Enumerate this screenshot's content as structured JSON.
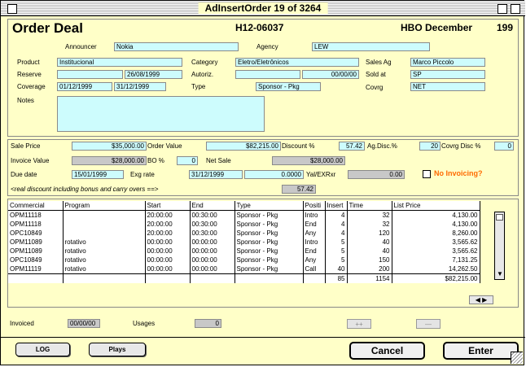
{
  "window": {
    "title": "AdInsertOrder 19 of 3264"
  },
  "header": {
    "heading": "Order Deal",
    "order_id": "H12-06037",
    "channel_period": "HBO December",
    "year": "199"
  },
  "deal": {
    "announcer_label": "Announcer",
    "announcer": "Nokia",
    "agency_label": "Agency",
    "agency": "LEW",
    "product_label": "Product",
    "product": "Institucional",
    "category_label": "Category",
    "category": "Eletro/Eletrônicos",
    "sales_ag_label": "Sales Ag",
    "sales_ag": "Marco Piccolo",
    "reserve_label": "Reserve",
    "reserve_1": "",
    "reserve_2": "26/08/1999",
    "autoriz_label": "Autoriz.",
    "autoriz_1": "",
    "autoriz_2": "00/00/00",
    "sold_at_label": "Sold at",
    "sold_at": "SP",
    "coverage_label": "Coverage",
    "coverage_from": "01/12/1999",
    "coverage_to": "31/12/1999",
    "type_label": "Type",
    "type": "Sponsor - Pkg",
    "covrg_label": "Covrg",
    "covrg": "NET",
    "notes_label": "Notes",
    "notes": ""
  },
  "pricing": {
    "sale_price_label": "Sale Price",
    "sale_price": "$35,000.00",
    "order_value_label": "Order Value",
    "order_value": "$82,215.00",
    "discount_label": "Discount %",
    "discount": "57.42",
    "ag_disc_label": "Ag.Disc.%",
    "ag_disc": "20",
    "covrg_disc_label": "Covrg Disc %",
    "covrg_disc": "0",
    "invoice_value_label": "Invoice Value",
    "invoice_value": "$28,000.00",
    "bo_label": "BO %",
    "bo": "0",
    "net_sale_label": "Net Sale",
    "net_sale": "$28,000.00",
    "due_date_label": "Due date",
    "due_date": "15/01/1999",
    "exg_rate_label": "Exg rate",
    "exg_rate_date": "31/12/1999",
    "exg_rate": "0.0000",
    "yal_label": "Yal/EXRxr",
    "yal": "0.00",
    "no_invoicing_label": "No Invoicing?",
    "real_discount_label": "<real discount including bonus and carry overs ==>",
    "real_discount": "57.42"
  },
  "table": {
    "headers": [
      "Commercial",
      "Program",
      "Start",
      "End",
      "Type",
      "Positi",
      "Insert",
      "Time",
      "List Price"
    ],
    "rows": [
      [
        "OPM11118",
        "",
        "20:00:00",
        "00:30:00",
        "Sponsor - Pkg",
        "Intro",
        "4",
        "32",
        "4,130.00"
      ],
      [
        "OPM11118",
        "",
        "20:00:00",
        "00:30:00",
        "Sponsor - Pkg",
        "End",
        "4",
        "32",
        "4,130.00"
      ],
      [
        "OPC10849",
        "",
        "20:00:00",
        "00:30:00",
        "Sponsor - Pkg",
        "Any",
        "4",
        "120",
        "8,260.00"
      ],
      [
        "OPM11089",
        "rotativo",
        "00:00:00",
        "00:00:00",
        "Sponsor - Pkg",
        "Intro",
        "5",
        "40",
        "3,565.62"
      ],
      [
        "OPM11089",
        "rotativo",
        "00:00:00",
        "00:00:00",
        "Sponsor - Pkg",
        "End",
        "5",
        "40",
        "3,565.62"
      ],
      [
        "OPC10849",
        "rotativo",
        "00:00:00",
        "00:00:00",
        "Sponsor - Pkg",
        "Any",
        "5",
        "150",
        "7,131.25"
      ],
      [
        "OPM11119",
        "rotativo",
        "00:00:00",
        "00:00:00",
        "Sponsor - Pkg",
        "Call",
        "40",
        "200",
        "14,262.50"
      ]
    ],
    "totals": {
      "insert": "85",
      "time": "1154",
      "list_price": "$82,215.00"
    }
  },
  "footer": {
    "invoiced_label": "Invoiced",
    "invoiced": "00/00/00",
    "usages_label": "Usages",
    "usages": "0",
    "plus_label": "++",
    "minus_label": "—",
    "log_label": "LOG",
    "plays_label": "Plays",
    "cancel_label": "Cancel",
    "enter_label": "Enter"
  }
}
